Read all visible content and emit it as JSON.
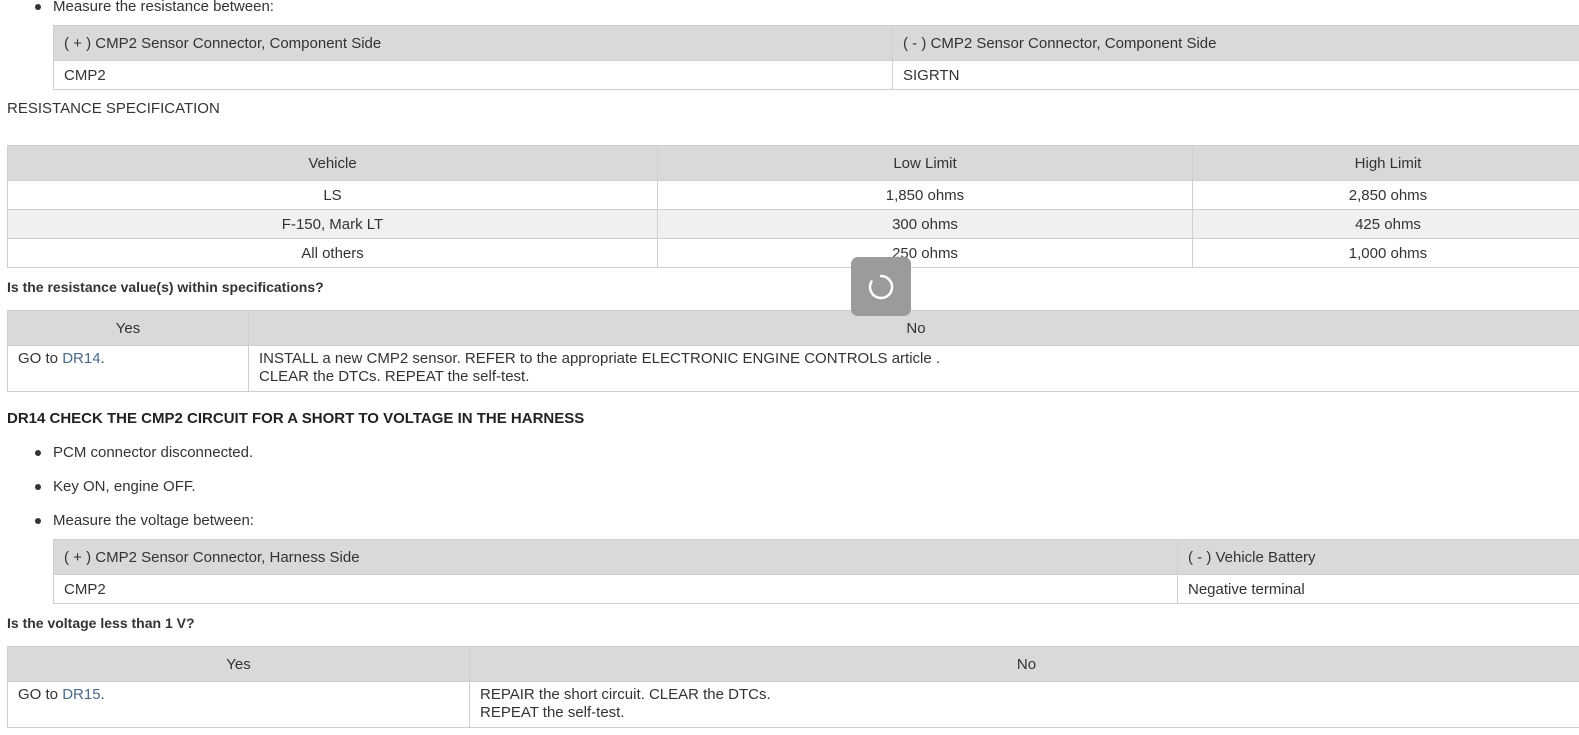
{
  "section1": {
    "measure_label": "Measure the resistance between:",
    "conn_table": {
      "headers": [
        "( + ) CMP2 Sensor Connector, Component Side",
        "( - ) CMP2 Sensor Connector, Component Side"
      ],
      "row": [
        "CMP2",
        "SIGRTN"
      ]
    },
    "spec_title": "RESISTANCE SPECIFICATION",
    "spec_table": {
      "headers": [
        "Vehicle",
        "Low Limit",
        "High Limit"
      ],
      "rows": [
        [
          "LS",
          "1,850 ohms",
          "2,850 ohms"
        ],
        [
          "F-150, Mark LT",
          "300 ohms",
          "425 ohms"
        ],
        [
          "All others",
          "250 ohms",
          "1,000 ohms"
        ]
      ]
    },
    "question": "Is the resistance value(s) within specifications?",
    "answer_table": {
      "headers": [
        "Yes",
        "No"
      ],
      "yes_prefix": "GO to",
      "yes_link": "DR14",
      "yes_suffix": ".",
      "no_line1": "INSTALL a new CMP2 sensor. REFER to the appropriate ELECTRONIC ENGINE CONTROLS article .",
      "no_line2": "CLEAR the DTCs. REPEAT the self-test."
    }
  },
  "section2": {
    "heading": "DR14 CHECK THE CMP2 CIRCUIT FOR A SHORT TO VOLTAGE IN THE HARNESS",
    "bullets": [
      "PCM connector disconnected.",
      "Key ON, engine OFF.",
      "Measure the voltage between:"
    ],
    "conn_table": {
      "headers": [
        "( + ) CMP2 Sensor Connector, Harness Side",
        "( - ) Vehicle Battery"
      ],
      "row": [
        "CMP2",
        "Negative terminal"
      ]
    },
    "question": "Is the voltage less than 1 V?",
    "answer_table": {
      "headers": [
        "Yes",
        "No"
      ],
      "yes_prefix": "GO to",
      "yes_link": "DR15",
      "yes_suffix": ".",
      "no_line1": "REPAIR the short circuit. CLEAR the DTCs.",
      "no_line2": "REPEAT the self-test."
    }
  },
  "spinner": {
    "icon": "loading-spinner-icon"
  }
}
